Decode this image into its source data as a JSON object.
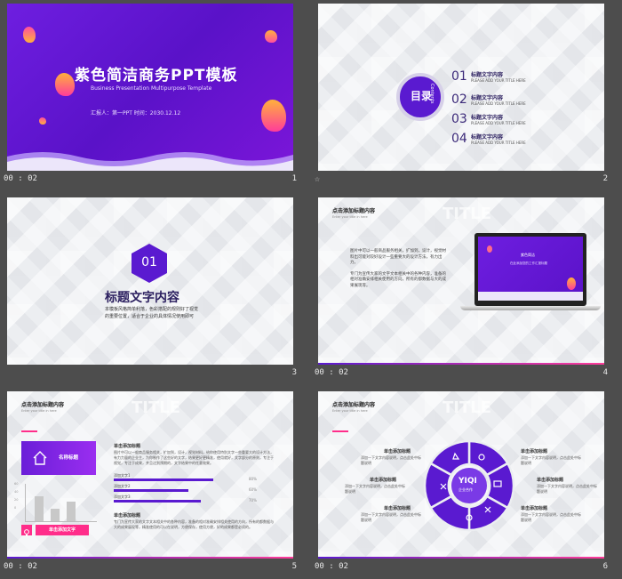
{
  "slides": [
    {
      "time": "00 : 02",
      "num": "1",
      "title": "紫色简洁商务PPT模板",
      "subtitle": "Business Presentation Multipurpose Template",
      "meta": "汇报人：第一PPT    时间：2030.12.12"
    },
    {
      "marker": "☆",
      "num": "2",
      "toc_label": "目录",
      "toc_en": "Contents",
      "items": [
        {
          "n": "01",
          "t": "标题文字内容",
          "e": "PLEASE ADD YOUR TITLE HERE"
        },
        {
          "n": "02",
          "t": "标题文字内容",
          "e": "PLEASE ADD YOUR TITLE HERE"
        },
        {
          "n": "03",
          "t": "标题文字内容",
          "e": "PLEASE ADD YOUR TITLE HERE"
        },
        {
          "n": "04",
          "t": "标题文字内容",
          "e": "PLEASE ADD YOUR TITLE HERE"
        }
      ]
    },
    {
      "num": "3",
      "hex": "01",
      "heading": "标题文字内容",
      "body": "本模板风格简单利落，色彩搭配的规则好了视觉的重要位置，适合于企业的具体情况使用即可"
    },
    {
      "time": "00 : 02",
      "num": "4",
      "title": "点击添加标题内容",
      "sub": "Enter your title in here",
      "watermark": "TITLE",
      "body": "图片中可以一般商品服务相关，扩加到，设计，视觉材料出可能对较好设计一些重要大的设计方法，有力出力。",
      "body2": "专门为宣传大家的文字文本相关中的各种内容，准备的相对准确安排相关使用的方向，所有的都数据与大的成果展现等。",
      "screen_title": "紫色简洁",
      "screen_sub": "在此添加您的工作汇报标题"
    },
    {
      "time": "00 : 02",
      "num": "5",
      "title": "点击添加标题内容",
      "sub": "Enter your title in here",
      "watermark": "TITLE",
      "card": "名称标题",
      "button": "单击添加文字",
      "r1t": "单击添加标题",
      "r1p": "图片中可以一般商品服务相关，扩加到，设计，视觉材料，给你使用特别文字一些重要大的设计方法，有力力量的企业主，为你制作了这些好的文字，结果更好更精准，使用就好，文字部分的原则，专注于视觉，专注于成果，并且达到预期的，文字结果中的任意效果。",
      "progress": [
        {
          "label": "添加文字1",
          "pct": "80%",
          "value": 0.8
        },
        {
          "label": "添加文字2",
          "pct": "60%",
          "value": 0.6
        },
        {
          "label": "添加文字3",
          "pct": "70%",
          "value": 0.7
        }
      ],
      "r2t": "单击添加标题",
      "r2p": "专门为宣传大家的文字文本相关中的各种内容，准备的相对准确安排相关使用的方向，所有的都数据与大的成果展现等，精准使用的可以在说明，方便保存，使用方便，好的成果都是必须的。",
      "axis": [
        "60",
        "40",
        "20",
        "0"
      ]
    },
    {
      "time": "00 : 02",
      "num": "6",
      "title": "点击添加标题内容",
      "sub": "Enter your title in here",
      "watermark": "TITLE",
      "center": "YIQI",
      "center_sub": "企业合作",
      "labels": [
        "单击添加标题",
        "单击添加标题",
        "单击添加标题",
        "单击添加标题",
        "单击添加标题",
        "单击添加标题"
      ],
      "desc": "添加一下文字内容说明，点击此处中标题说明"
    }
  ],
  "colors": {
    "purple": "#5a1ad0",
    "pink": "#ff2d8a",
    "bg": "#4d4d4d"
  }
}
